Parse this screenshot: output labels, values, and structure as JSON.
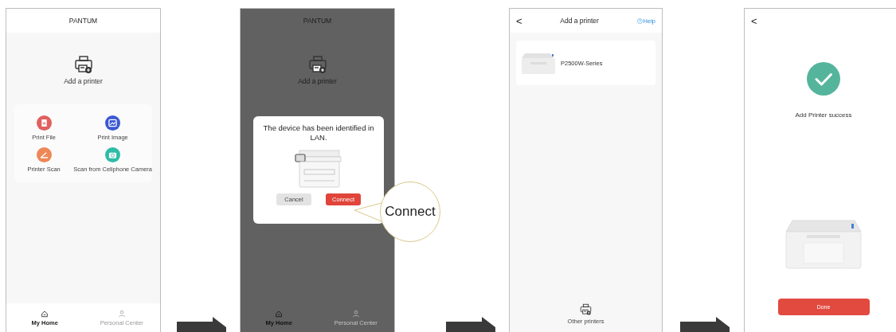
{
  "screens": [
    {
      "kind": "home",
      "dimmed": false,
      "title": "PANTUM",
      "add_printer": "Add a printer",
      "actions": [
        {
          "kind": "file",
          "label": "Print File",
          "color": "#e0605e"
        },
        {
          "kind": "image",
          "label": "Print Image",
          "color": "#3a58d4"
        },
        {
          "kind": "scan",
          "label": "Printer Scan",
          "color": "#ee8757"
        },
        {
          "kind": "camera",
          "label": "Scan from Cellphone Camera",
          "color": "#2fbca6"
        }
      ],
      "tabs": [
        {
          "kind": "home",
          "label": "My Home",
          "selected": true
        },
        {
          "kind": "person",
          "label": "Personal Center",
          "selected": false
        }
      ]
    },
    {
      "kind": "home",
      "dimmed": true,
      "title": "PANTUM",
      "add_printer": "Add a printer",
      "tabs": [
        {
          "kind": "home",
          "label": "My Home",
          "selected": true
        },
        {
          "kind": "person",
          "label": "Personal Center",
          "selected": false
        }
      ],
      "dialog": {
        "message": "The device has been identified in LAN.",
        "buttons": [
          {
            "kind": "secondary",
            "label": "Cancel"
          },
          {
            "kind": "primary",
            "label": "Connect"
          }
        ]
      },
      "callout": "Connect"
    },
    {
      "kind": "list",
      "back": "<",
      "title": "Add a printer",
      "help": "Help",
      "printers": [
        {
          "name": "P2500W-Series"
        }
      ],
      "footer": "Other printers"
    },
    {
      "kind": "success",
      "back": "<",
      "message": "Add Printer success",
      "button": "Done"
    }
  ]
}
